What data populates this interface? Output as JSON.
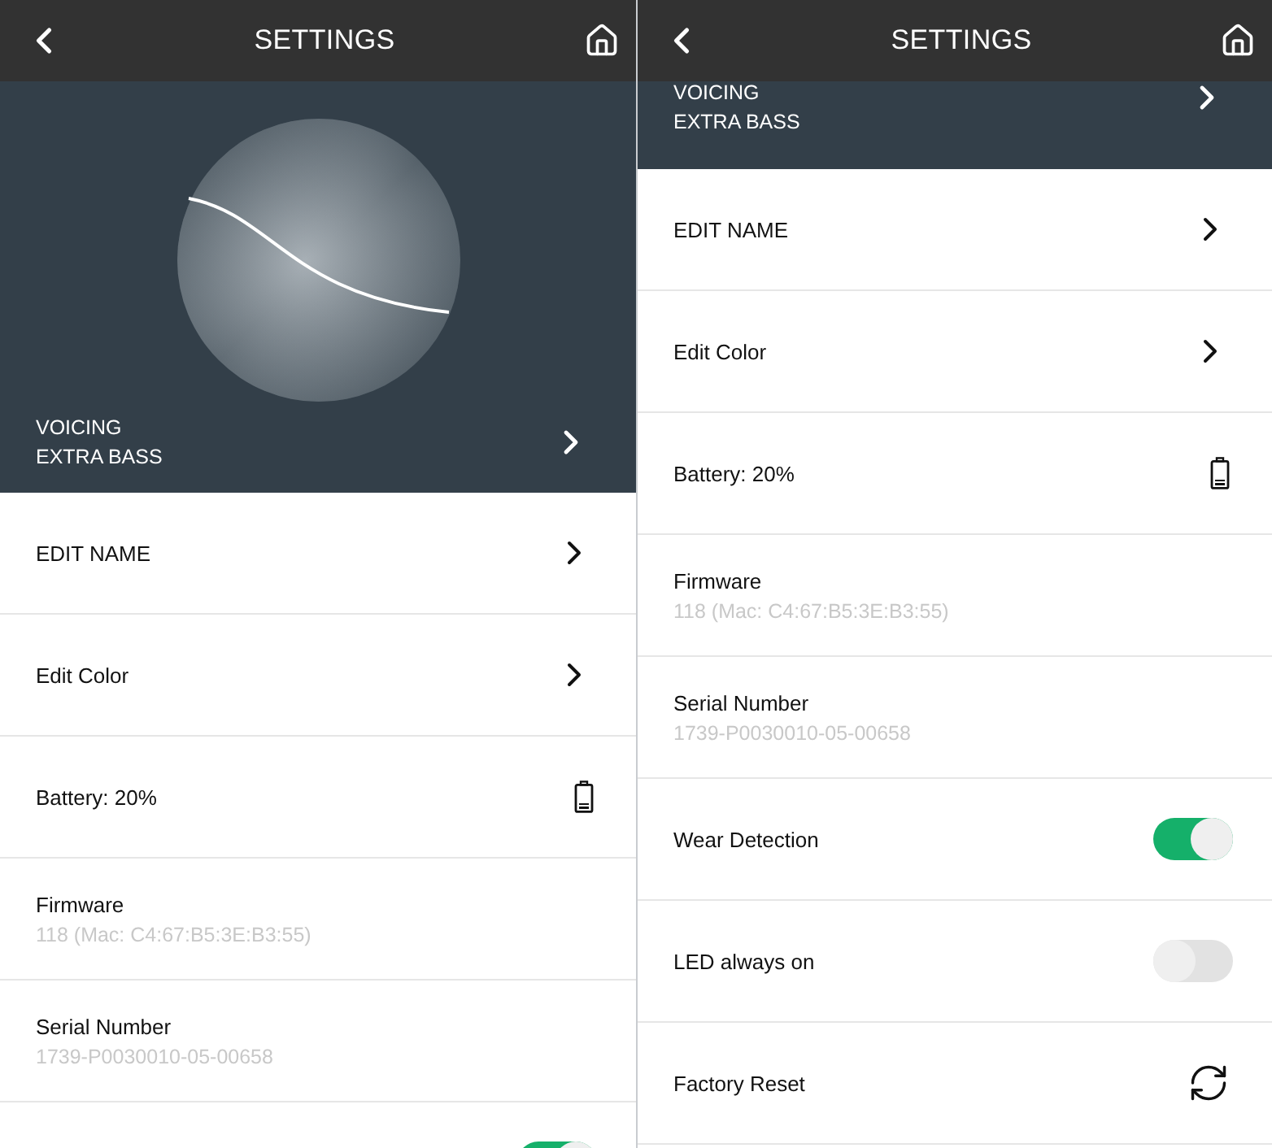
{
  "screens": [
    {
      "title": "SETTINGS",
      "hero": {
        "kind": "full",
        "lines": [
          "VOICING",
          "EXTRA BASS"
        ]
      },
      "rows": [
        {
          "kind": "link",
          "label": "EDIT NAME"
        },
        {
          "kind": "link",
          "label": "Edit Color"
        },
        {
          "kind": "battery",
          "label": "Battery: 20%"
        },
        {
          "kind": "info",
          "label": "Firmware",
          "value": "118 (Mac: C4:67:B5:3E:B3:55)"
        },
        {
          "kind": "info",
          "label": "Serial Number",
          "value": "1739-P0030010-05-00658"
        },
        {
          "kind": "toggle",
          "on": true
        }
      ]
    },
    {
      "title": "SETTINGS",
      "hero": {
        "kind": "scrolled",
        "lines": [
          "VOICING",
          "EXTRA BASS"
        ]
      },
      "rows": [
        {
          "kind": "link",
          "label": "EDIT NAME"
        },
        {
          "kind": "link",
          "label": "Edit Color"
        },
        {
          "kind": "battery",
          "label": "Battery: 20%"
        },
        {
          "kind": "info",
          "label": "Firmware",
          "value": "118 (Mac: C4:67:B5:3E:B3:55)"
        },
        {
          "kind": "info",
          "label": "Serial Number",
          "value": "1739-P0030010-05-00658"
        },
        {
          "kind": "toggle",
          "label": "Wear Detection",
          "on": true
        },
        {
          "kind": "toggle",
          "label": "LED always on",
          "on": false
        },
        {
          "kind": "reset",
          "label": "Factory Reset"
        }
      ]
    }
  ]
}
